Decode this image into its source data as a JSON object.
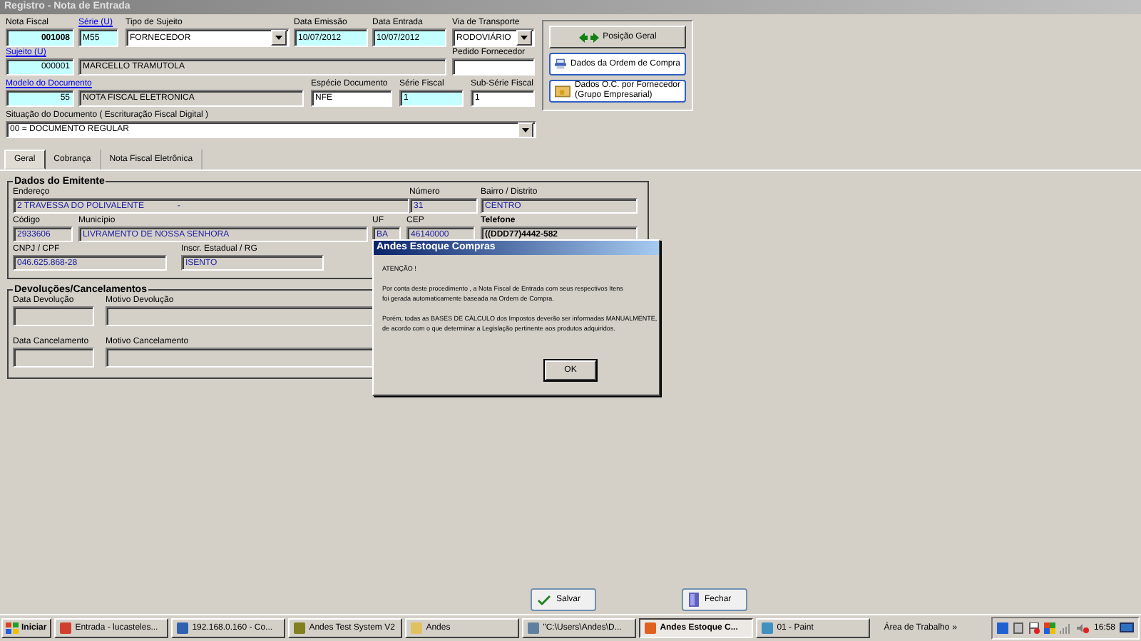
{
  "window": {
    "title": "Registro - Nota de Entrada"
  },
  "header_rows": [
    [
      {
        "label": "Nota Fiscal",
        "value": "001008",
        "kind": "text",
        "required": true,
        "readonly": false
      },
      {
        "label": "Série (U)",
        "value": "M55",
        "kind": "text",
        "required": true,
        "readonly": false,
        "link": true
      },
      {
        "label": "Tipo de Sujeito",
        "value": "FORNECEDOR",
        "kind": "combo",
        "required": false,
        "readonly": false
      },
      {
        "label": "Data Emissão",
        "value": "10/07/2012",
        "kind": "text",
        "required": true,
        "readonly": false
      },
      {
        "label": "Data Entrada",
        "value": "10/07/2012",
        "kind": "text",
        "required": true,
        "readonly": false
      },
      {
        "label": "Via de Transporte",
        "value": "RODOVIÁRIO",
        "kind": "combo",
        "required": false,
        "readonly": false
      }
    ],
    [
      {
        "label": "Sujeito (U)",
        "value": "000001",
        "kind": "text",
        "required": true,
        "readonly": false,
        "link": true
      },
      {
        "value": "MARCELLO TRAMUTOLA",
        "kind": "text",
        "readonly": true
      },
      {
        "label": "Pedido Fornecedor",
        "kind": "text",
        "required": false,
        "readonly": false
      }
    ],
    [
      {
        "label": "Modelo do Documento",
        "value": "55",
        "kind": "text",
        "required": true,
        "readonly": false,
        "link": true
      },
      {
        "value": "NOTA FISCAL ELETRONICA",
        "kind": "text",
        "readonly": true
      },
      {
        "label": "Espécie Documento",
        "value": "NFE",
        "kind": "text",
        "required": false,
        "readonly": false
      },
      {
        "label": "Série Fiscal",
        "value": "1",
        "kind": "text",
        "required": true,
        "readonly": false
      },
      {
        "label": "Sub-Série Fiscal",
        "value": "1",
        "kind": "text",
        "required": false,
        "readonly": false
      }
    ],
    [
      {
        "label": "Situação do Documento ( Escrituração Fiscal Digital )",
        "value": "00 = DOCUMENTO REGULAR",
        "kind": "combo",
        "required": false,
        "readonly": false
      }
    ]
  ],
  "side_buttons": [
    {
      "label": "Posição Geral",
      "kind": "plain"
    },
    {
      "label": "Dados da Ordem de Compra",
      "kind": "outlined"
    },
    {
      "label": "Dados O.C. por Fornecedor\n(Grupo Empresarial)",
      "kind": "outlined"
    }
  ],
  "tabs": [
    {
      "label": "Geral",
      "selected": true
    },
    {
      "label": "Cobrança",
      "selected": false
    },
    {
      "label": "Nota Fiscal Eletrônica",
      "selected": false
    }
  ],
  "groups": [
    {
      "title": "Dados do Emitente",
      "fields": [
        {
          "label": "Endereço",
          "value": "2 TRAVESSA DO POLIVALENTE              -",
          "emphasis": false
        },
        {
          "label": "Número",
          "value": "31",
          "emphasis": false
        },
        {
          "label": "Bairro / Distrito",
          "value": "CENTRO",
          "emphasis": false
        },
        {
          "label": "Código",
          "value": "2933606",
          "emphasis": false
        },
        {
          "label": "Município",
          "value": "LIVRAMENTO DE NOSSA SENHORA",
          "emphasis": false
        },
        {
          "label": "UF",
          "value": "BA",
          "emphasis": false
        },
        {
          "label": "CEP",
          "value": "46140000",
          "emphasis": false
        },
        {
          "label": "Telefone",
          "value": "((DDD77)4442-582",
          "emphasis": true
        },
        {
          "label": "CNPJ / CPF",
          "value": "046.625.868-28",
          "emphasis": false
        },
        {
          "label": "Inscr. Estadual / RG",
          "value": "ISENTO",
          "emphasis": false
        }
      ]
    },
    {
      "title": "Devoluções/Cancelamentos",
      "fields": [
        {
          "label": "Data Devolução",
          "emphasis": false
        },
        {
          "label": "Motivo Devolução",
          "emphasis": false
        },
        {
          "label": "Data Cancelamento",
          "emphasis": false
        },
        {
          "label": "Motivo Cancelamento",
          "emphasis": false
        }
      ]
    }
  ],
  "dialog": {
    "title": "Andes Estoque Compras",
    "heading": "ATENÇÃO !",
    "paragraphs": [
      "Por conta deste procedimento , a Nota Fiscal de Entrada com seus respectivos Itens\nfoi gerada automaticamente baseada na Ordem de Compra.",
      "Porém, todas as BASES DE CÁLCULO dos Impostos deverão ser informadas MANUALMENTE,\nde acordo com o que determinar a Legislação pertinente aos produtos adquiridos."
    ],
    "button": "OK"
  },
  "actions": [
    {
      "label": "Salvar",
      "kind": "save"
    },
    {
      "label": "Fechar",
      "kind": "close"
    }
  ],
  "taskbar": {
    "start": "Iniciar",
    "items": [
      {
        "label": "Entrada - lucasteles...",
        "selected": false
      },
      {
        "label": "192.168.0.160 - Co...",
        "selected": false
      },
      {
        "label": "Andes Test System V2",
        "selected": false
      },
      {
        "label": "Andes",
        "selected": false
      },
      {
        "label": "\"C:\\Users\\Andes\\D...",
        "selected": false
      },
      {
        "label": "Andes Estoque C...",
        "selected": true
      },
      {
        "label": "01 - Paint",
        "selected": false
      }
    ],
    "toolbar": "Área de Trabalho",
    "chevron": "»",
    "clock": "16:58"
  }
}
